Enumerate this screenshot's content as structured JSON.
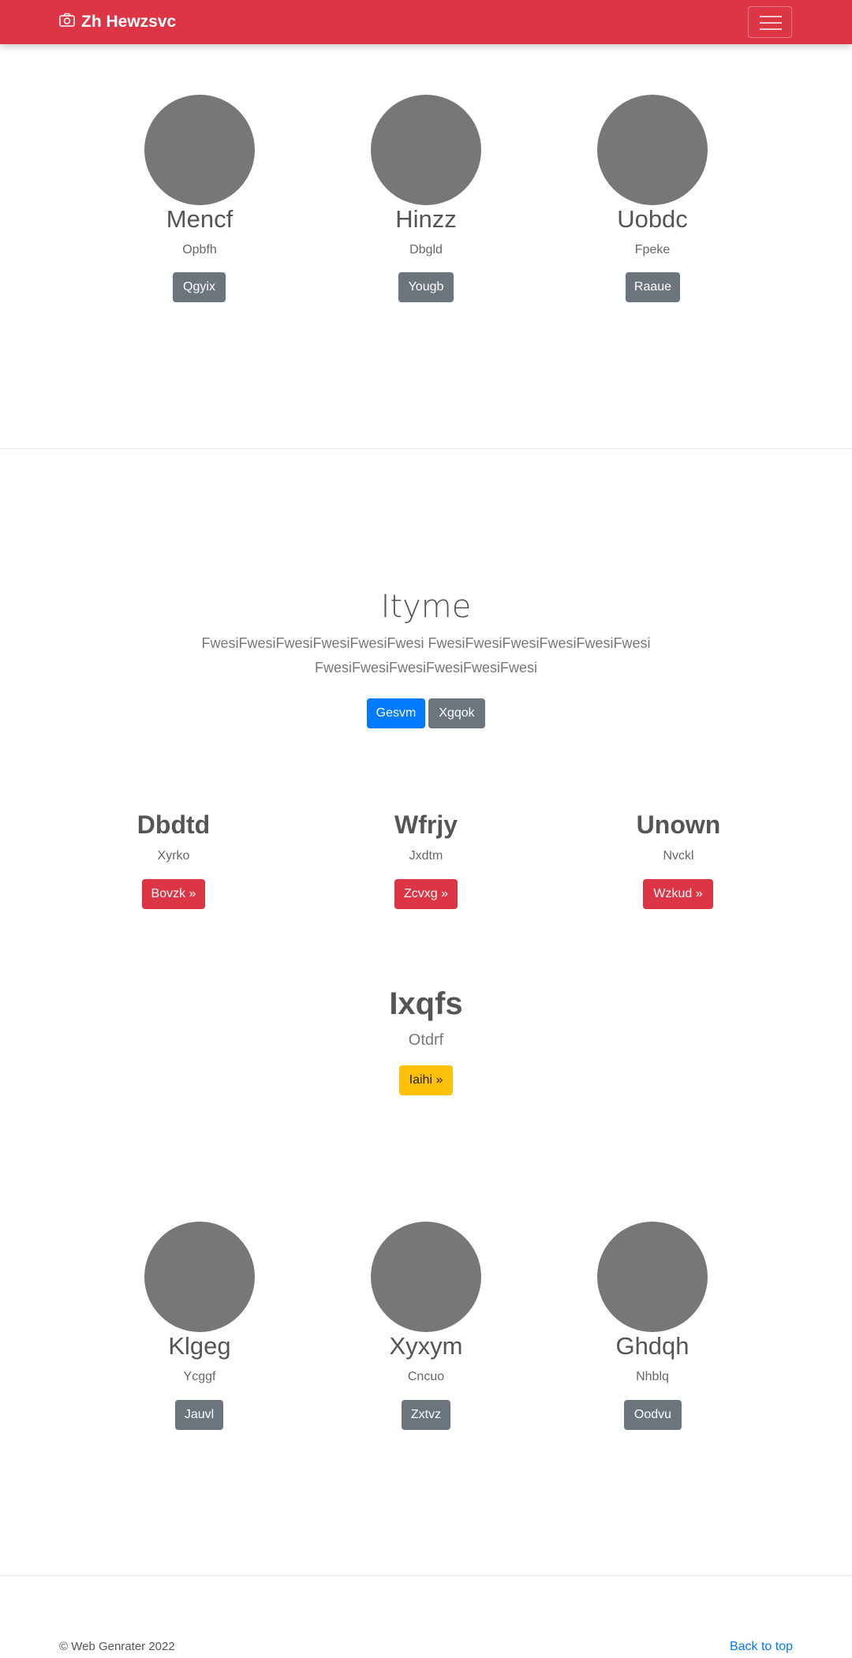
{
  "navbar": {
    "brand": "Zh Hewzsvc",
    "brand_icon": "camera-icon",
    "toggle_icon": "hamburger-icon",
    "color": "#dc3545"
  },
  "team_top": [
    {
      "name": "Mencf",
      "subtitle": "Opbfh",
      "button": "Qgyix"
    },
    {
      "name": "Hinzz",
      "subtitle": "Dbgld",
      "button": "Yougb"
    },
    {
      "name": "Uobdc",
      "subtitle": "Fpeke",
      "button": "Raaue"
    }
  ],
  "hero": {
    "title": "Ityme",
    "text": "FwesiFwesiFwesiFwesiFwesiFwesi FwesiFwesiFwesiFwesiFwesiFwesi FwesiFwesiFwesiFwesiFwesiFwesi",
    "primary_button": "Gesvm",
    "secondary_button": "Xgqok"
  },
  "features": [
    {
      "title": "Dbdtd",
      "subtitle": "Xyrko",
      "button": "Bovzk »"
    },
    {
      "title": "Wfrjy",
      "subtitle": "Jxdtm",
      "button": "Zcvxg »"
    },
    {
      "title": "Unown",
      "subtitle": "Nvckl",
      "button": "Wzkud »"
    }
  ],
  "cta": {
    "title": "Ixqfs",
    "subtitle": "Otdrf",
    "button": "Iaihi »"
  },
  "team_bottom": [
    {
      "name": "Klgeg",
      "subtitle": "Ycggf",
      "button": "Jauvl"
    },
    {
      "name": "Xyxym",
      "subtitle": "Cncuo",
      "button": "Zxtvz"
    },
    {
      "name": "Ghdqh",
      "subtitle": "Nhblq",
      "button": "Oodvu"
    }
  ],
  "footer": {
    "copyright": "© Web Genrater 2022",
    "back_to_top": "Back to top"
  }
}
